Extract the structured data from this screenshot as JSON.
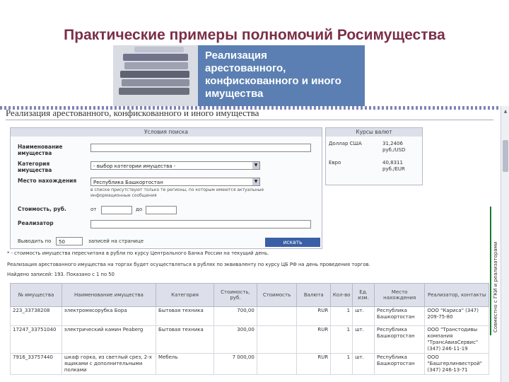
{
  "slide": {
    "title": "Практические примеры полномочий Росимущества"
  },
  "banner": {
    "text_lines": [
      "Реализация",
      "арестованного,",
      "конфискованного и иного",
      "имущества"
    ]
  },
  "page": {
    "title": "Реализация арестованного, конфискованного и иного имущества"
  },
  "search": {
    "header": "Условия поиска",
    "name_label": "Наименование имущества",
    "category_label": "Категория имущества",
    "category_value": "- выбор категории имущества -",
    "location_label": "Место нахождения",
    "location_value": "Республика Башкортостан",
    "location_note": "в списке присутствуют только те регионы, по которым имеются актуальные информационные сообщения",
    "cost_label": "Стоимость, руб.",
    "from_label": "от",
    "to_label": "до",
    "seller_label": "Реализатор",
    "page_size_prefix": "Выводить по",
    "page_size_value": "50",
    "page_size_suffix": "записей на странице",
    "search_button": "искать"
  },
  "rates": {
    "header": "Курсы валют",
    "items": [
      {
        "currency": "Доллар США",
        "value": "31,2406",
        "unit": "руб./USD"
      },
      {
        "currency": "Евро",
        "value": "40,8311",
        "unit": "руб./EUR"
      }
    ]
  },
  "notes": {
    "footnote1": "* - стоимость имущества пересчитана в рубли по курсу Центрального Банка России на текущий день.",
    "footnote2": "Реализация арестованного имущества на торгах будет осуществляться в рублях по эквиваленту по курсу ЦБ РФ на день проведения торгов.",
    "found": "Найдено записей: 193. Показано с 1 по 50"
  },
  "table": {
    "headers": [
      "№ имущества",
      "Наименование имущества",
      "Категория",
      "Стоимость, руб.",
      "Стоимость",
      "Валюта",
      "Кол-во",
      "Ед. изм.",
      "Место нахождения",
      "Реализатор, контакты"
    ],
    "rows": [
      [
        "223_33738208",
        "электромясорубка Бора",
        "Бытовая техника",
        "700,00",
        "",
        "RUR",
        "1",
        "шт.",
        "Республика Башкортостан",
        "ООО \"Кариса\" (347) 209-75-80"
      ],
      [
        "17247_33751040",
        "электрический камин Peaberg",
        "Бытовая техника",
        "300,00",
        "",
        "RUR",
        "1",
        "шт.",
        "Республика Башкортостан",
        "ООО \"Транстодивы компания \"ТрансАвиаСервис\" (347) 246-11-19"
      ],
      [
        "7916_33757440",
        "шкаф горка, из светлый срез, 2-х ящиками с дополнительными полками",
        "Мебель",
        "7 000,00",
        "",
        "RUR",
        "1",
        "шт.",
        "Республика Башкортостан",
        "ООО \"Башгерлинвестрой\" (347) 246-13-71"
      ]
    ]
  },
  "side_label": {
    "text": "Совместно с ГКИ и реализаторами"
  }
}
